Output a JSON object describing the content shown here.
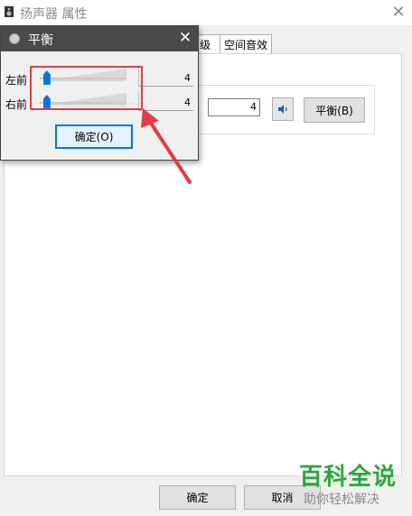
{
  "main_window": {
    "title": "扬声器 属性",
    "close_icon": "close-icon",
    "tabs": [
      {
        "label": "级"
      },
      {
        "label": "空间音效"
      }
    ],
    "level": {
      "value": "4",
      "mute_icon": "speaker-icon",
      "balance_label": "平衡(B)"
    },
    "buttons": {
      "ok_label": "确定",
      "cancel_label": "取消"
    }
  },
  "balance_dialog": {
    "title": "平衡",
    "close_icon": "close-icon",
    "channels": [
      {
        "label": "左前",
        "value": "4",
        "slider_fraction": 0.04
      },
      {
        "label": "右前",
        "value": "4",
        "slider_fraction": 0.04
      }
    ],
    "ok_label": "确定(O)"
  },
  "annotation": {
    "color": "#e43d3d"
  },
  "watermark": {
    "title": "百科全说",
    "subtitle": "助你轻松解决",
    "color": "#2aa83a"
  }
}
